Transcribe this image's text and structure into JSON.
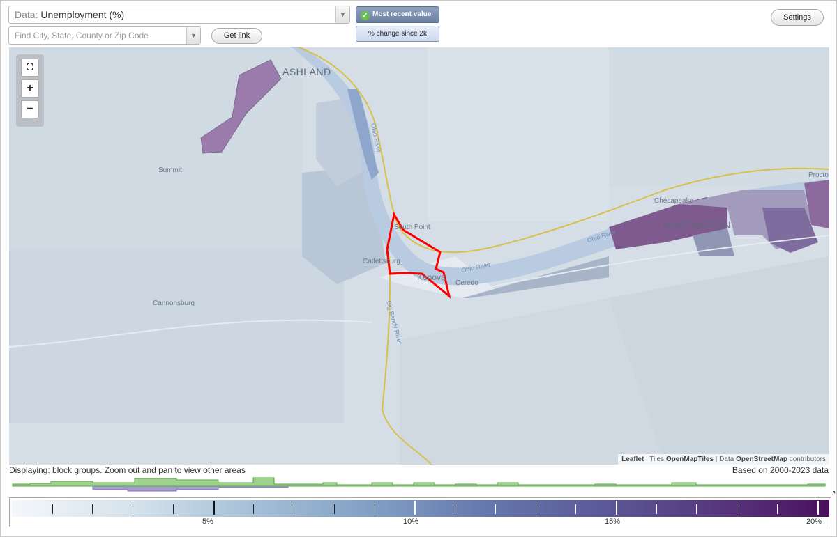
{
  "controls": {
    "data_prefix": "Data:",
    "data_value": "Unemployment (%)",
    "search_placeholder": "Find City, State, County or Zip Code",
    "get_link": "Get link",
    "most_recent": "Most recent value",
    "percent_change": "% change since 2k",
    "settings": "Settings",
    "dropdown_icon": "chevron-down-icon",
    "check_icon": "check-icon"
  },
  "map": {
    "labels": {
      "ashland": "ASHLAND",
      "summit": "Summit",
      "south_point": "South Point",
      "catlettsburg": "Catlettsburg",
      "kenova": "Kenova",
      "ceredo": "Ceredo",
      "cannonsburg": "Cannonsburg",
      "chesapeake": "Chesapeake",
      "huntington": "HUNTINGTON",
      "proctorville": "Procto",
      "ohio_river_1": "Ohio River",
      "ohio_river_2": "Ohio River",
      "ohio_river_3": "Ohio River",
      "big_sandy": "Big Sandy River"
    },
    "zoom_controls": [
      "fit-extent-icon",
      "zoom-in-icon",
      "zoom-out-icon"
    ],
    "zoom_in": "+",
    "zoom_out": "−",
    "attribution": {
      "leaflet": "Leaflet",
      "sep1": " | Tiles ",
      "tiles": "OpenMapTiles",
      "sep2": " | Data ",
      "data": "OpenStreetMap",
      "contributors": " contributors"
    },
    "highlight_color": "#ff0000",
    "border_color": "#d8c14a"
  },
  "footer": {
    "display_note": "Displaying: block groups. Zoom out and pan to view other areas",
    "based_note": "Based on 2000-2023 data"
  },
  "legend": {
    "labels": [
      "5%",
      "10%",
      "15%",
      "20%"
    ],
    "min": 0,
    "max": 20.3,
    "unknown": "?",
    "colors": [
      "#f4f7fa",
      "#a9c3d9",
      "#6678ad",
      "#56337a",
      "#4a0f5c"
    ]
  }
}
